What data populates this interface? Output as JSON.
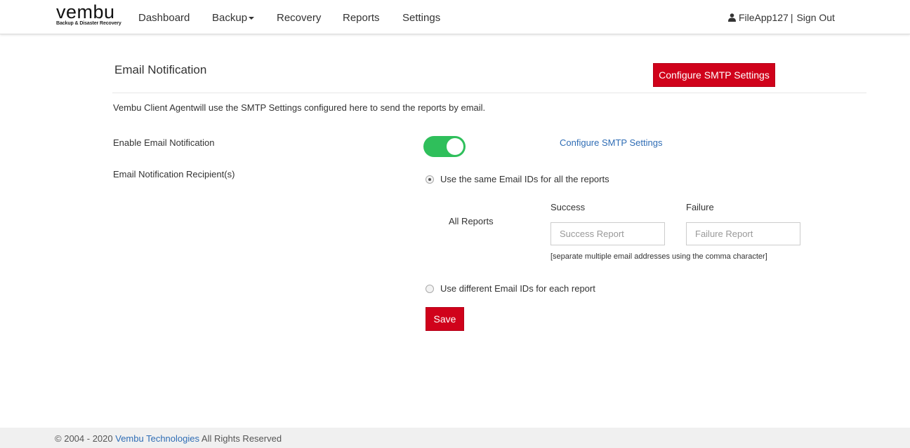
{
  "header": {
    "logo": {
      "word": "vembu",
      "tagline": "Backup & Disaster Recovery"
    },
    "nav": [
      {
        "label": "Dashboard"
      },
      {
        "label": "Backup"
      },
      {
        "label": "Recovery"
      },
      {
        "label": "Reports"
      },
      {
        "label": "Settings"
      }
    ],
    "user": {
      "name": "FileApp127",
      "separator": "|",
      "sign_out": "Sign Out",
      "icon": "user-icon"
    }
  },
  "page": {
    "title": "Email Notification",
    "configure_smtp_button": "Configure SMTP Settings",
    "description": "Vembu Client Agentwill use the SMTP Settings configured here to send the reports by email.",
    "enable_label": "Enable Email Notification",
    "enable_on": true,
    "configure_smtp_link": "Configure SMTP Settings",
    "recipients_label": "Email Notification Recipient(s)",
    "option_same": "Use the same Email IDs for all the reports",
    "option_same_selected": true,
    "all_reports_label": "All Reports",
    "success_header": "Success",
    "failure_header": "Failure",
    "success_value": "",
    "success_placeholder": "Success Report",
    "failure_value": "",
    "failure_placeholder": "Failure Report",
    "hint": "[separate multiple email addresses using the comma character]",
    "option_different": "Use different Email IDs for each report",
    "option_different_selected": false,
    "save_button": "Save"
  },
  "footer": {
    "copyright_symbol": "©",
    "years": "2004 - 2020",
    "company": "Vembu Technologies",
    "rights": "All Rights Reserved"
  },
  "colors": {
    "accent_red": "#d0021b",
    "toggle_on": "#2fbf5b",
    "link_blue": "#2f6db5"
  }
}
